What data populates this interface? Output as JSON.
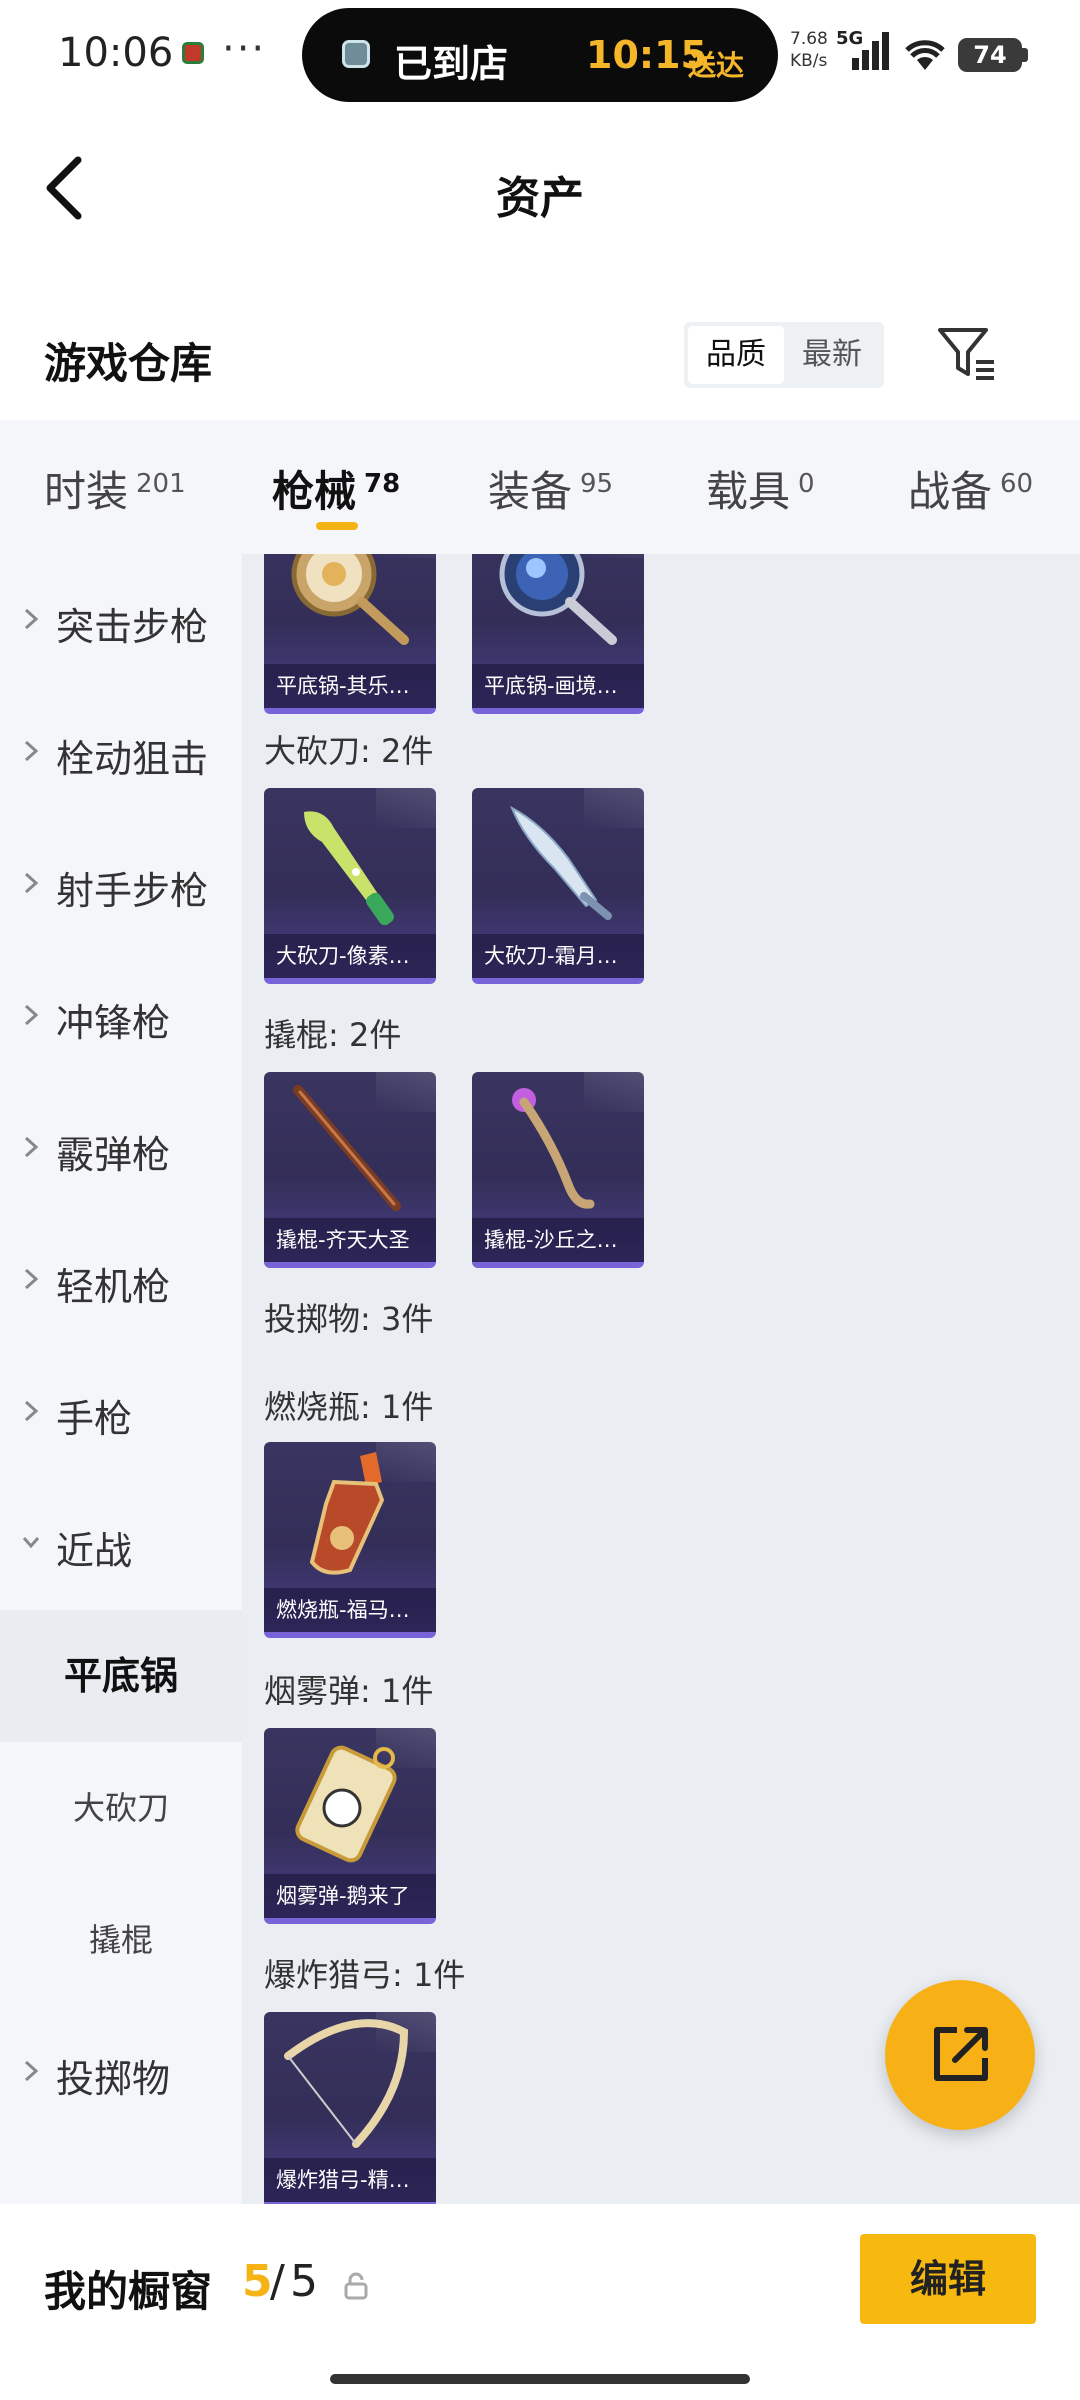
{
  "status_bar": {
    "time": "10:06",
    "dots": "···",
    "pill_status": "已到店",
    "pill_eta_time": "10:15",
    "pill_eta_suffix": "送达",
    "net_speed_value": "7.68",
    "net_speed_unit": "KB/s",
    "network": "5G",
    "battery": "74"
  },
  "header": {
    "back_icon": "chevron-left-icon",
    "title": "资产"
  },
  "warehouse": {
    "title": "游戏仓库",
    "sort_options": [
      "品质",
      "最新"
    ],
    "sort_selected": "品质",
    "filter_icon": "filter-icon"
  },
  "tabs": [
    {
      "label": "时装",
      "count": "201"
    },
    {
      "label": "枪械",
      "count": "78",
      "active": true
    },
    {
      "label": "装备",
      "count": "95"
    },
    {
      "label": "载具",
      "count": "0"
    },
    {
      "label": "战备",
      "count": "60"
    }
  ],
  "sidebar": {
    "items": [
      {
        "label": "突击步枪"
      },
      {
        "label": "栓动狙击"
      },
      {
        "label": "射手步枪"
      },
      {
        "label": "冲锋枪"
      },
      {
        "label": "霰弹枪"
      },
      {
        "label": "轻机枪"
      },
      {
        "label": "手枪"
      },
      {
        "label": "近战",
        "expanded": true
      }
    ],
    "subitems": [
      {
        "label": "平底锅",
        "active": true
      },
      {
        "label": "大砍刀"
      },
      {
        "label": "撬棍"
      }
    ],
    "after": [
      {
        "label": "投掷物"
      }
    ]
  },
  "content": {
    "sections": [
      {
        "label": "大砍刀: 2件"
      },
      {
        "label": "撬棍: 2件"
      },
      {
        "label": "投掷物: 3件"
      },
      {
        "label": "燃烧瓶: 1件"
      },
      {
        "label": "烟雾弹: 1件"
      },
      {
        "label": "爆炸猎弓: 1件"
      }
    ],
    "cards": [
      {
        "name": "平底锅-其乐…",
        "icon": "frying-pan-icon"
      },
      {
        "name": "平底锅-画境…",
        "icon": "frying-pan-icon"
      },
      {
        "name": "大砍刀-像素…",
        "icon": "machete-icon"
      },
      {
        "name": "大砍刀-霜月…",
        "icon": "machete-icon"
      },
      {
        "name": "撬棍-齐天大圣",
        "icon": "crowbar-icon"
      },
      {
        "name": "撬棍-沙丘之…",
        "icon": "crowbar-icon"
      },
      {
        "name": "燃烧瓶-福马…",
        "icon": "molotov-icon"
      },
      {
        "name": "烟雾弹-鹅来了",
        "icon": "smoke-grenade-icon"
      },
      {
        "name": "爆炸猎弓-精…",
        "icon": "bow-icon"
      }
    ]
  },
  "fab": {
    "icon": "share-icon"
  },
  "bottom_bar": {
    "label": "我的橱窗",
    "count": "5",
    "slash": "/",
    "total": "5",
    "lock_icon": "lock-icon",
    "edit_label": "编辑"
  },
  "colors": {
    "accent": "#f5b316",
    "card_bg": "#3a3560",
    "card_border": "#7864d8",
    "sidebar_bg": "#f4f6fa",
    "content_bg": "#eaedf2"
  }
}
